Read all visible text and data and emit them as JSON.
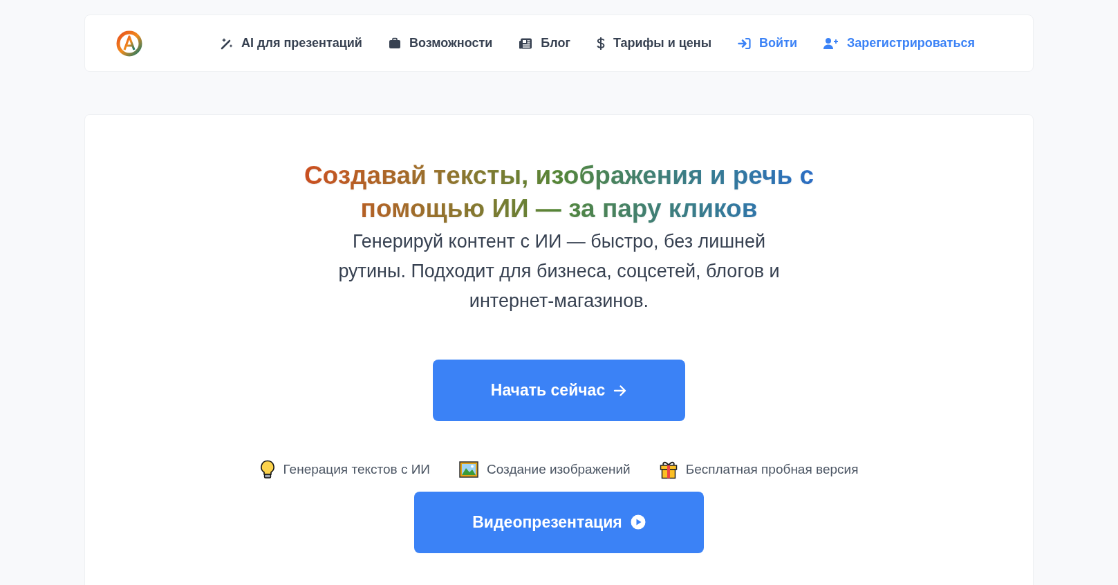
{
  "nav": {
    "items": [
      {
        "label": "AI для презентаций",
        "kind": "link"
      },
      {
        "label": "Возможности",
        "kind": "link"
      },
      {
        "label": "Блог",
        "kind": "link"
      },
      {
        "label": "Тарифы и цены",
        "kind": "link"
      },
      {
        "label": "Войти",
        "kind": "auth"
      },
      {
        "label": "Зарегистрироваться",
        "kind": "auth"
      }
    ]
  },
  "hero": {
    "title": "Создавай тексты, изображения и речь с помощью ИИ — за пару кликов",
    "subtitle": "Генерируй контент с ИИ — быстро, без лишней рутины. Подходит для бизнеса, соцсетей, блогов и интернет-магазинов.",
    "primary_button": "Начать сейчас",
    "features": [
      "Генерация текстов с ИИ",
      "Создание изображений",
      "Бесплатная пробная версия"
    ],
    "video_button": "Видеопрезентация"
  }
}
